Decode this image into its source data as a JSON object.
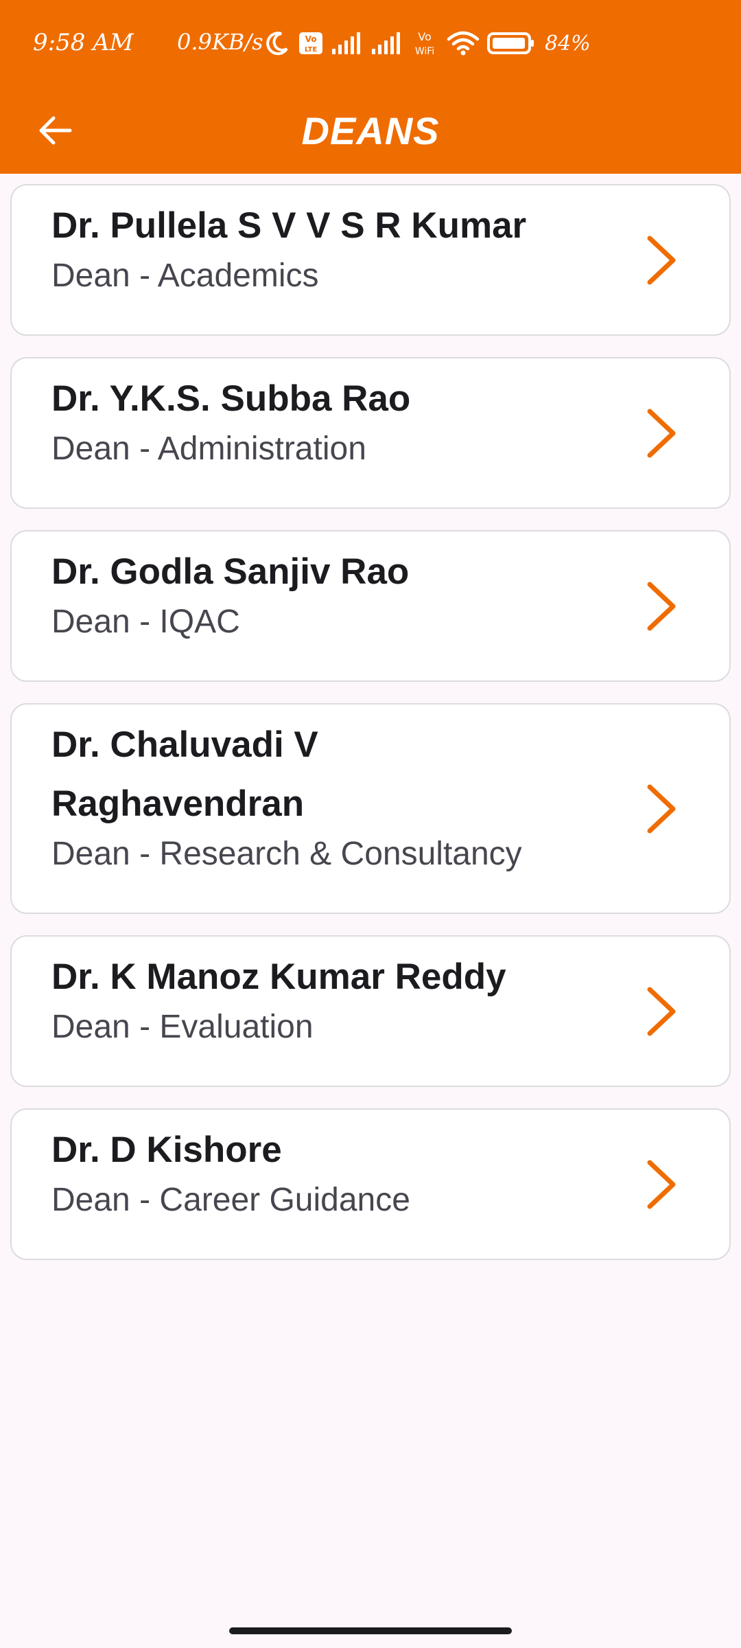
{
  "status_bar": {
    "time": "9:58 AM",
    "network_speed": "0.9KB/s",
    "battery": "84%",
    "icons": [
      "moon-icon",
      "volte-icon",
      "signal-icon",
      "signal-icon",
      "vowifi-icon",
      "wifi-icon",
      "battery-icon"
    ]
  },
  "app_bar": {
    "title": "DEANS",
    "back_icon": "arrow-left-icon"
  },
  "colors": {
    "primary": "#EF6C00",
    "background": "#FDF7FC",
    "card": "#FFFFFF",
    "name_text": "#1C1B1F",
    "role_text": "#49454F"
  },
  "deans": [
    {
      "name": "Dr. Pullela S V V S R Kumar",
      "role": "Dean - Academics"
    },
    {
      "name": "Dr. Y.K.S. Subba Rao",
      "role": "Dean - Administration"
    },
    {
      "name": "Dr. Godla Sanjiv Rao",
      "role": "Dean - IQAC"
    },
    {
      "name": "Dr. Chaluvadi V Raghavendran",
      "role": "Dean - Research & Consultancy"
    },
    {
      "name": "Dr. K Manoz Kumar Reddy",
      "role": "Dean - Evaluation"
    },
    {
      "name": "Dr. D Kishore",
      "role": "Dean - Career Guidance"
    }
  ]
}
